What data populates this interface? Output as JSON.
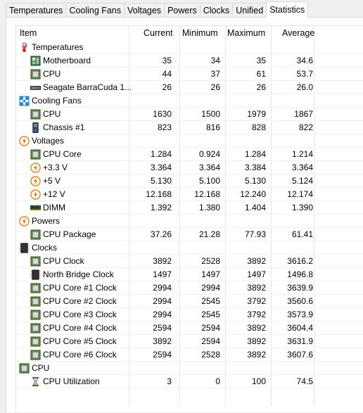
{
  "tabs": [
    {
      "label": "Temperatures",
      "active": false
    },
    {
      "label": "Cooling Fans",
      "active": false
    },
    {
      "label": "Voltages",
      "active": false
    },
    {
      "label": "Powers",
      "active": false
    },
    {
      "label": "Clocks",
      "active": false
    },
    {
      "label": "Unified",
      "active": false
    },
    {
      "label": "Statistics",
      "active": true
    }
  ],
  "columns": [
    "Item",
    "Current",
    "Minimum",
    "Maximum",
    "Average"
  ],
  "rows": [
    {
      "type": "group",
      "icon": "thermometer-icon",
      "label": "Temperatures"
    },
    {
      "type": "item",
      "icon": "motherboard-icon",
      "label": "Motherboard",
      "values": [
        "35",
        "34",
        "35",
        "34.6"
      ]
    },
    {
      "type": "item",
      "icon": "chip-icon",
      "label": "CPU",
      "values": [
        "44",
        "37",
        "61",
        "53.7"
      ]
    },
    {
      "type": "item",
      "icon": "hard-drive-icon",
      "label": "Seagate BarraCuda 1...",
      "values": [
        "26",
        "26",
        "26",
        "26.0"
      ]
    },
    {
      "type": "group",
      "icon": "fan-icon",
      "label": "Cooling Fans"
    },
    {
      "type": "item",
      "icon": "chip-icon",
      "label": "CPU",
      "values": [
        "1630",
        "1500",
        "1979",
        "1867"
      ]
    },
    {
      "type": "item",
      "icon": "chassis-icon",
      "label": "Chassis #1",
      "values": [
        "823",
        "816",
        "828",
        "822"
      ]
    },
    {
      "type": "group",
      "icon": "lightning-icon",
      "label": "Voltages"
    },
    {
      "type": "item",
      "icon": "chip-icon",
      "label": "CPU Core",
      "values": [
        "1.284",
        "0.924",
        "1.284",
        "1.214"
      ]
    },
    {
      "type": "item",
      "icon": "lightning-icon",
      "label": "+3.3 V",
      "values": [
        "3.364",
        "3.364",
        "3.384",
        "3.364"
      ]
    },
    {
      "type": "item",
      "icon": "lightning-icon",
      "label": "+5 V",
      "values": [
        "5.130",
        "5.100",
        "5.130",
        "5.124"
      ]
    },
    {
      "type": "item",
      "icon": "lightning-icon",
      "label": "+12 V",
      "values": [
        "12.168",
        "12.168",
        "12.240",
        "12.174"
      ]
    },
    {
      "type": "item",
      "icon": "memory-icon",
      "label": "DIMM",
      "values": [
        "1.392",
        "1.380",
        "1.404",
        "1.390"
      ]
    },
    {
      "type": "group",
      "icon": "lightning-icon",
      "label": "Powers"
    },
    {
      "type": "item",
      "icon": "chip-icon",
      "label": "CPU Package",
      "values": [
        "37.26",
        "21.28",
        "77.93",
        "61.41"
      ]
    },
    {
      "type": "group",
      "icon": "clock-chip-icon",
      "label": "Clocks"
    },
    {
      "type": "item",
      "icon": "chip-icon",
      "label": "CPU Clock",
      "values": [
        "3892",
        "2528",
        "3892",
        "3616.2"
      ]
    },
    {
      "type": "item",
      "icon": "clock-chip-icon",
      "label": "North Bridge Clock",
      "values": [
        "1497",
        "1497",
        "1497",
        "1496.8"
      ]
    },
    {
      "type": "item",
      "icon": "chip-icon",
      "label": "CPU Core #1 Clock",
      "values": [
        "2994",
        "2994",
        "3892",
        "3639.9"
      ]
    },
    {
      "type": "item",
      "icon": "chip-icon",
      "label": "CPU Core #2 Clock",
      "values": [
        "2994",
        "2545",
        "3792",
        "3560.6"
      ]
    },
    {
      "type": "item",
      "icon": "chip-icon",
      "label": "CPU Core #3 Clock",
      "values": [
        "2994",
        "2545",
        "3792",
        "3573.9"
      ]
    },
    {
      "type": "item",
      "icon": "chip-icon",
      "label": "CPU Core #4 Clock",
      "values": [
        "2594",
        "2594",
        "3892",
        "3604.4"
      ]
    },
    {
      "type": "item",
      "icon": "chip-icon",
      "label": "CPU Core #5 Clock",
      "values": [
        "3892",
        "2594",
        "3892",
        "3631.9"
      ]
    },
    {
      "type": "item",
      "icon": "chip-icon",
      "label": "CPU Core #6 Clock",
      "values": [
        "2594",
        "2528",
        "3892",
        "3607.6"
      ]
    },
    {
      "type": "group",
      "icon": "chip-icon",
      "label": "CPU"
    },
    {
      "type": "item",
      "icon": "hourglass-icon",
      "label": "CPU Utilization",
      "values": [
        "3",
        "0",
        "100",
        "74.5"
      ]
    }
  ]
}
